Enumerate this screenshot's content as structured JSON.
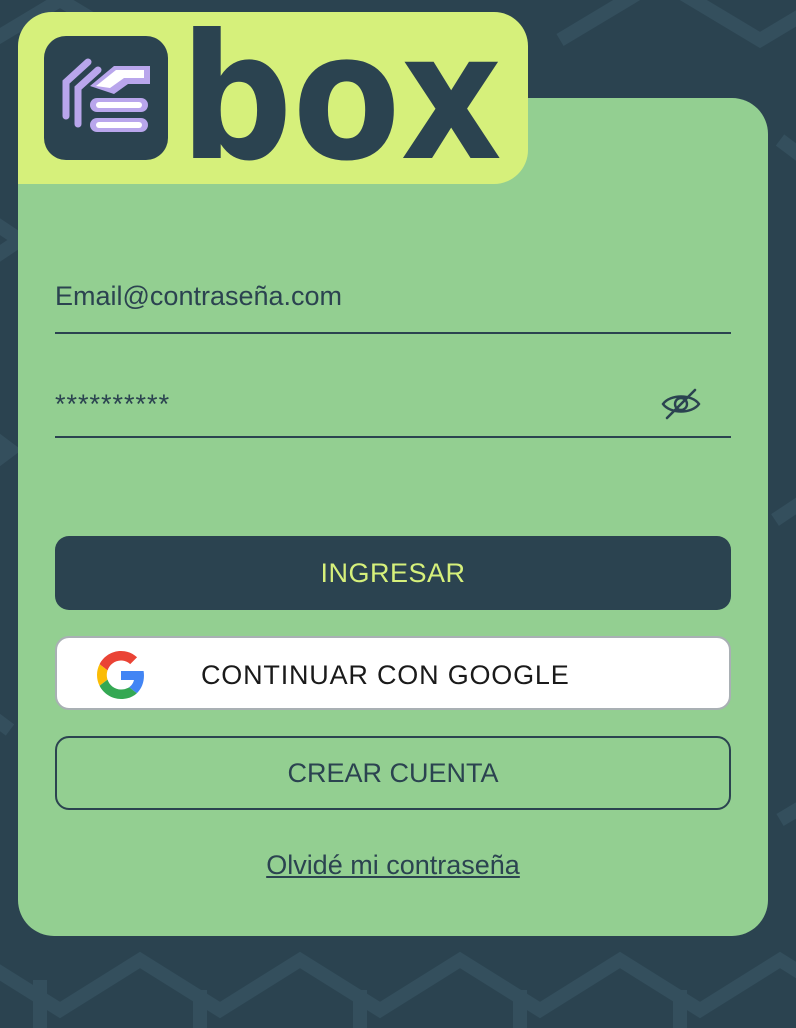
{
  "brand": {
    "name": "box",
    "colors": {
      "background": "#2b4350",
      "card": "#93cf91",
      "logo_tab": "#d6f07b",
      "dark": "#2b4350",
      "accent": "#d6f07b",
      "logo_stripes": "#b9a6ec"
    }
  },
  "form": {
    "email": {
      "placeholder": "Email@contraseña.com",
      "value": ""
    },
    "password": {
      "value": "**********",
      "toggle_icon": "eye-slash-icon"
    }
  },
  "buttons": {
    "login_label": "INGRESAR",
    "google_label": "CONTINUAR CON GOOGLE",
    "google_icon": "google-g-icon",
    "create_label": "CREAR CUENTA"
  },
  "links": {
    "forgot_password": "Olvidé mi contraseña"
  }
}
